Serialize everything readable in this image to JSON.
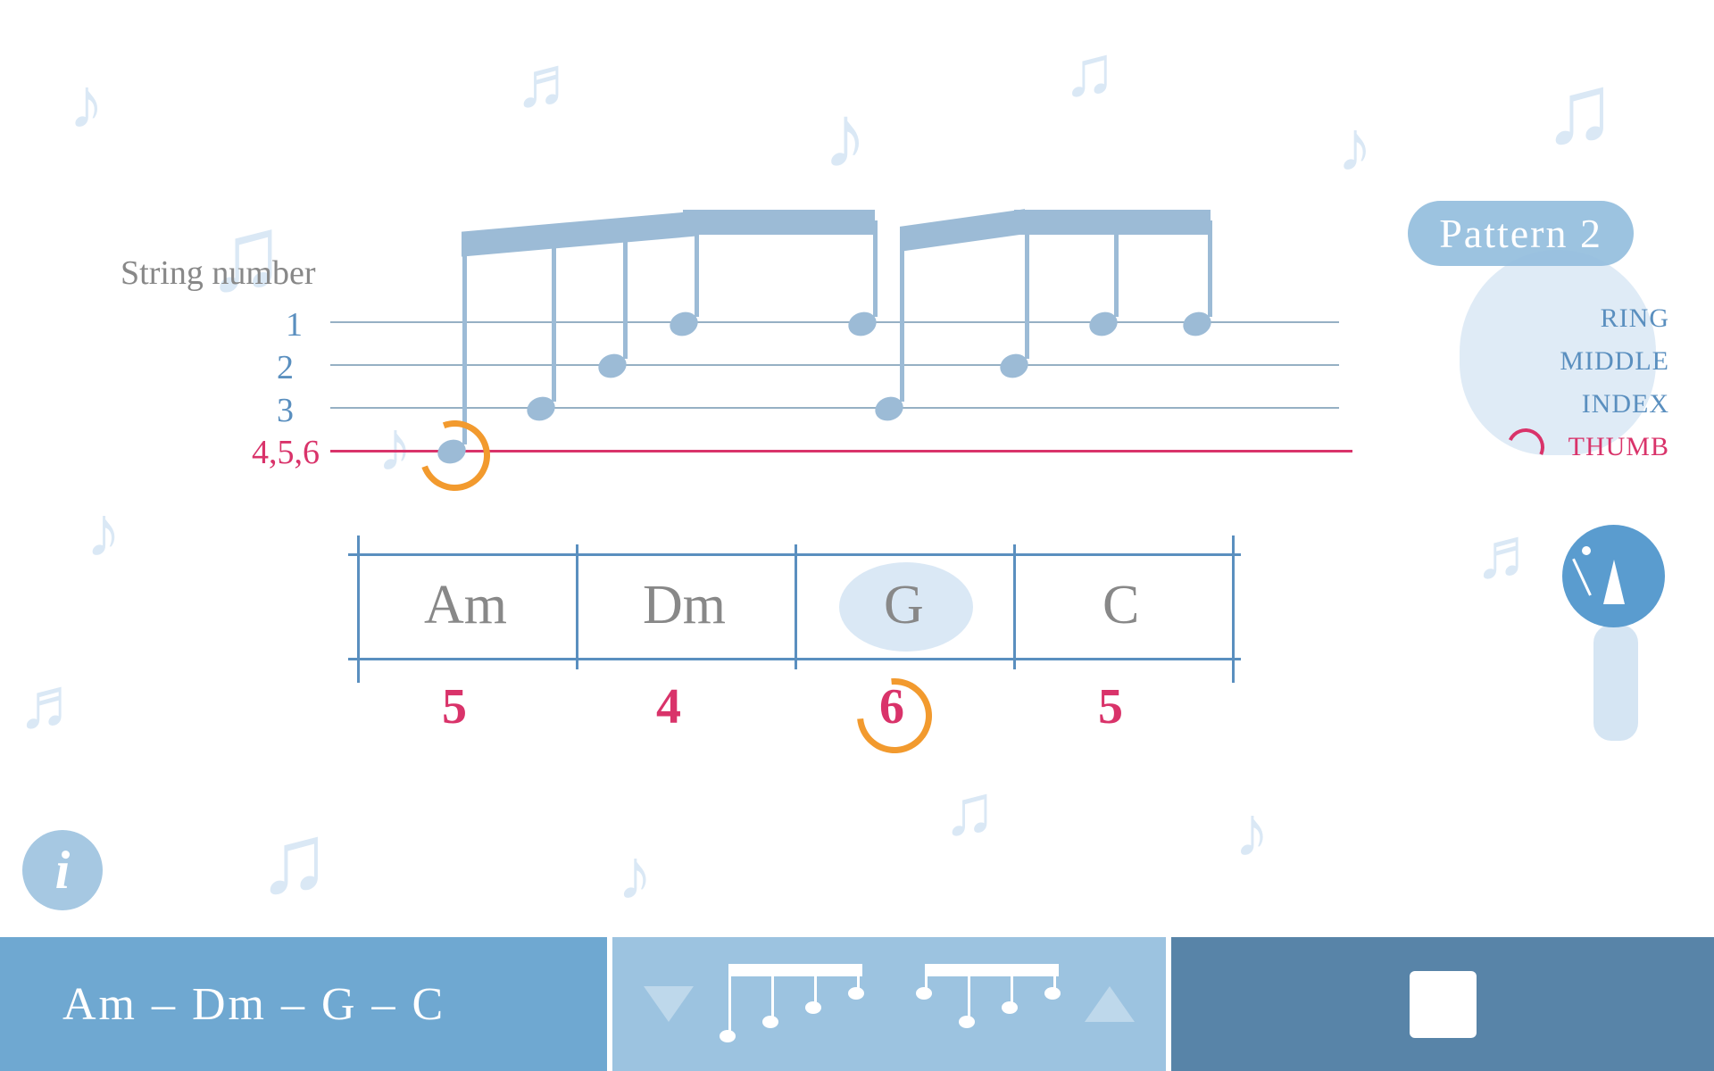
{
  "pattern_badge": "Pattern 2",
  "string_number_label": "String number",
  "string_numbers": {
    "one": "1",
    "two": "2",
    "three": "3",
    "thumb": "4,5,6"
  },
  "fingers": {
    "ring": "RING",
    "middle": "MIDDLE",
    "index": "INDEX",
    "thumb": "THUMB"
  },
  "staff": {
    "notes": [
      {
        "line": 3,
        "highlighted": true
      },
      {
        "line": 2
      },
      {
        "line": 1
      },
      {
        "line": 0
      },
      {
        "line": 0
      },
      {
        "line": 2
      },
      {
        "line": 1
      },
      {
        "line": 0
      }
    ]
  },
  "chords": [
    {
      "name": "Am",
      "bass": "5"
    },
    {
      "name": "Dm",
      "bass": "4"
    },
    {
      "name": "G",
      "bass": "6",
      "highlighted": true
    },
    {
      "name": "C",
      "bass": "5"
    }
  ],
  "info_glyph": "i",
  "bottom": {
    "chord_sequence": "Am – Dm – G – C"
  }
}
